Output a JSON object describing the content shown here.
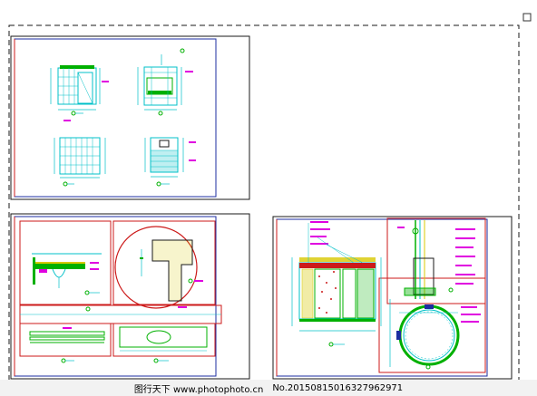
{
  "footer": {
    "site_text": "图行天下 www.photophoto.cn",
    "number_text": "No.20150815016327962971"
  },
  "colors": {
    "background": "#ffffff",
    "frame": "#1a1a1a",
    "inner_border_blue": "#1c2ea0",
    "red": "#cc1a1a",
    "cyan": "#00c0c8",
    "green": "#00b000",
    "magenta": "#e000e0",
    "yellow": "#d8c800",
    "footer_bg": "#f2f2f2"
  },
  "scrollbar_top_icon": "square-marker-icon"
}
